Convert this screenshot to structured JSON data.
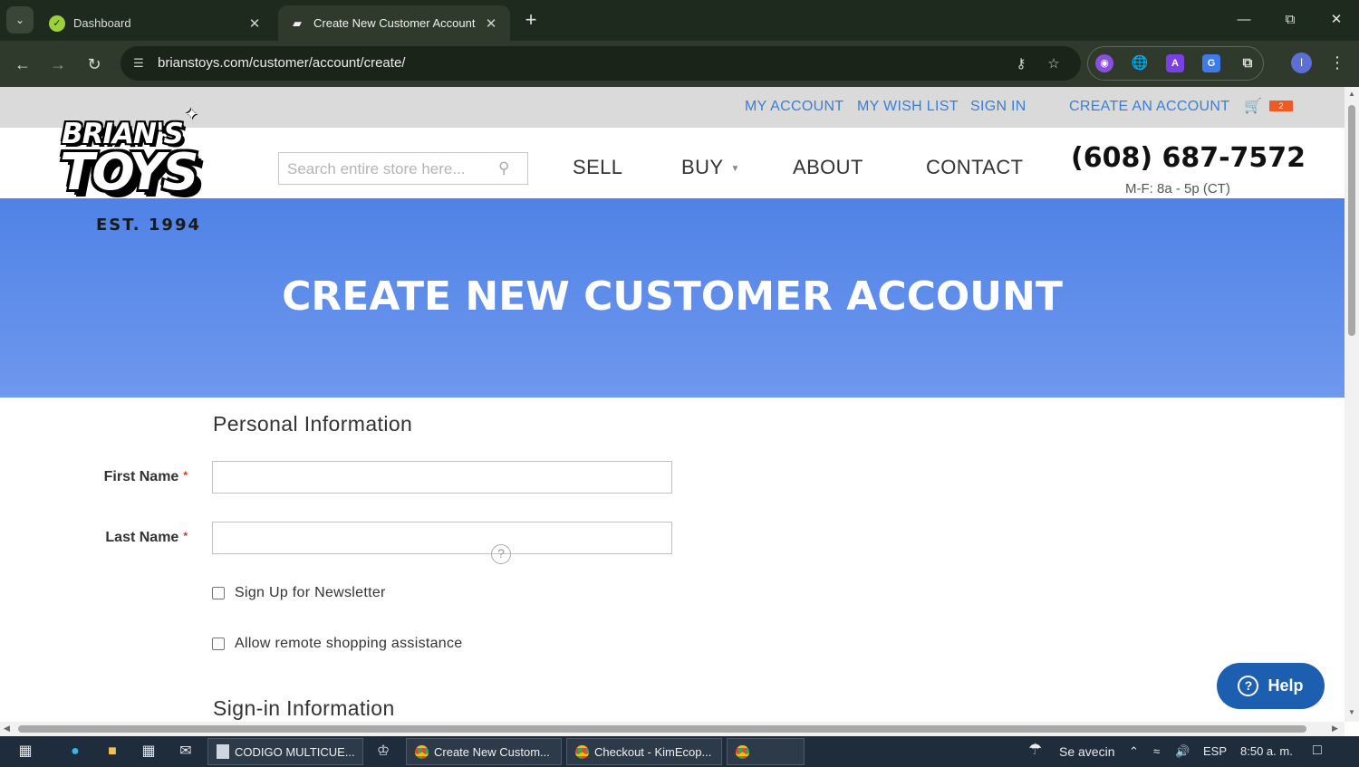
{
  "browser": {
    "tabs": [
      {
        "title": "Dashboard",
        "active": false
      },
      {
        "title": "Create New Customer Account",
        "active": true
      }
    ],
    "url": "brianstoys.com/customer/account/create/"
  },
  "site": {
    "toplinks": {
      "my_account": "MY ACCOUNT",
      "wishlist": "MY WISH LIST",
      "sign_in": "SIGN IN",
      "create_account": "CREATE AN ACCOUNT"
    },
    "cart_count": "2",
    "logo": {
      "line1": "BRIAN'S",
      "line2": "TOYS",
      "est": "EST. 1994"
    },
    "search_placeholder": "Search entire store here...",
    "nav": {
      "sell": "SELL",
      "buy": "BUY",
      "about": "ABOUT",
      "contact": "CONTACT"
    },
    "phone": "(608) 687-7572",
    "hours": "M-F: 8a - 5p (CT)"
  },
  "hero": {
    "title": "CREATE NEW CUSTOMER ACCOUNT"
  },
  "form": {
    "personal_title": "Personal Information",
    "first_name_label": "First Name",
    "last_name_label": "Last Name",
    "newsletter_label": "Sign Up for Newsletter",
    "remote_assist_label": "Allow remote shopping assistance",
    "signin_title": "Sign-in Information"
  },
  "help_button": "Help",
  "taskbar": {
    "apps": [
      {
        "label": "CODIGO MULTICUE..."
      },
      {
        "label": "Create New Custom..."
      },
      {
        "label": "Checkout - KimEcop..."
      }
    ],
    "weather": "Se avecin",
    "language": "ESP",
    "time": "8:50 a. m."
  },
  "colors": {
    "accent_link": "#3b7fd4",
    "hero_blue": "#4f82e6",
    "help_button": "#1c5fb0",
    "cart_badge": "#ef5a24",
    "required": "#e02b27"
  }
}
